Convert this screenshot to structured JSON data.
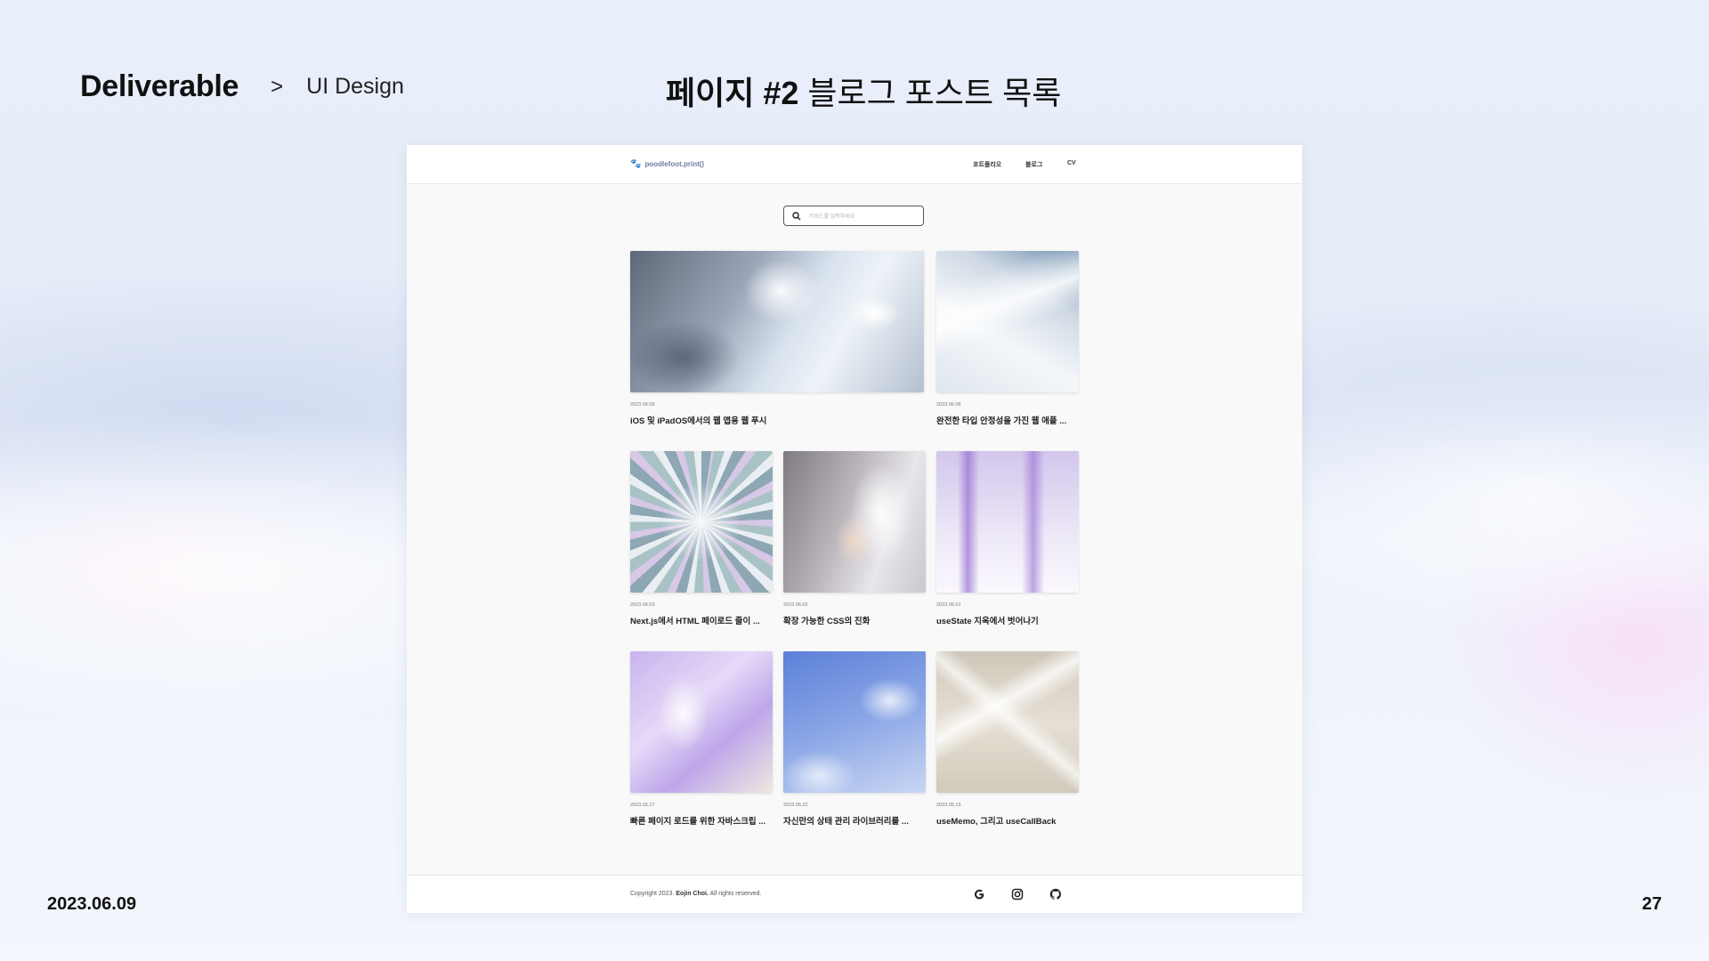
{
  "slide": {
    "section": "Deliverable",
    "separator": ">",
    "subsection": "UI Design",
    "title_bold": "페이지 #2",
    "title_rest": " 블로그 포스트 목록",
    "date": "2023.06.09",
    "page_number": "27"
  },
  "site": {
    "logo_text": "poodlefoot.print()",
    "logo_icon": "paw-icon",
    "nav": [
      "포트폴리오",
      "블로그",
      "CV"
    ],
    "search": {
      "placeholder": "키워드를 입력하세요",
      "value": "",
      "icon": "search-icon"
    },
    "posts": [
      {
        "date": "2023.06.09",
        "title": "iOS 및 iPadOS에서의 웹 앱용 웹 푸시"
      },
      {
        "date": "2023.06.06",
        "title": "완전한 타입 안정성을 가진 웹 애플 ..."
      },
      {
        "date": "2023.06.03",
        "title": "Next.js에서 HTML 페이로드 줄이 ..."
      },
      {
        "date": "2023.06.02",
        "title": "확장 가능한 CSS의 진화"
      },
      {
        "date": "2023.06.01",
        "title": "useState 지옥에서 벗어나기"
      },
      {
        "date": "2023.05.27",
        "title": "빠른 페이지 로드를 위한 자바스크립 ..."
      },
      {
        "date": "2023.05.22",
        "title": "자신만의 상태 관리 라이브러리를 ..."
      },
      {
        "date": "2023.05.15",
        "title": "useMemo, 그리고 useCallBack"
      }
    ],
    "footer": {
      "copyright_prefix": "Copyright 2023.",
      "copyright_name": "Eojin Choi.",
      "copyright_suffix": "All rights reserved.",
      "icons": [
        "google-icon",
        "instagram-icon",
        "github-icon"
      ]
    }
  }
}
